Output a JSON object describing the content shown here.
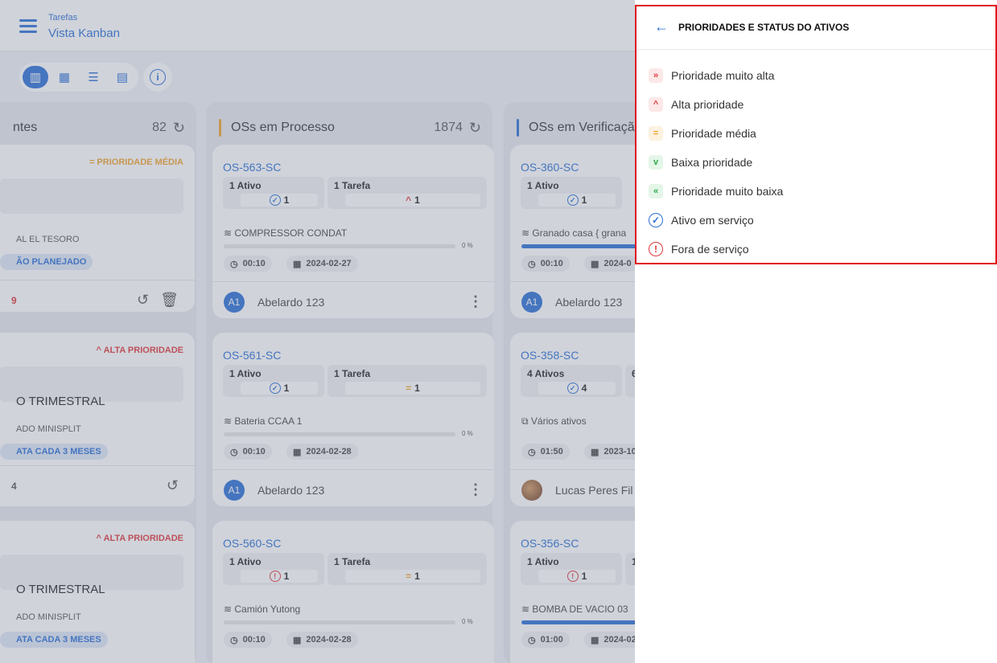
{
  "header": {
    "breadcrumb_small": "Tarefas",
    "breadcrumb_title": "Vista Kanban"
  },
  "view_toolbar": {
    "icons": [
      "kanban-icon",
      "calendar-icon",
      "checklist-icon",
      "clipboard-icon"
    ],
    "info_icon": "i"
  },
  "columns": [
    {
      "title": "ntes",
      "count": "82"
    },
    {
      "title": "OSs em Processo",
      "count": "1874"
    },
    {
      "title": "OSs em Verificaçã",
      "count": ""
    }
  ],
  "left_cards": [
    {
      "priority": "= PRIORIDADE MÉDIA",
      "big_text": "",
      "location": "AL EL TESORO",
      "pill": "ÃO PLANEJADO",
      "foot_fragment": "9"
    },
    {
      "priority": "^ ALTA PRIORIDADE",
      "big_text": "O TRIMESTRAL",
      "location": "ADO MINISPLIT",
      "pill": "ATA CADA 3 MESES",
      "foot_fragment": "4"
    },
    {
      "priority": "^ ALTA PRIORIDADE",
      "big_text": "O TRIMESTRAL",
      "location": "ADO MINISPLIT",
      "pill": "ATA CADA 3 MESES",
      "foot_fragment": ""
    }
  ],
  "process_cards": [
    {
      "code": "OS-563-SC",
      "assets_label": "1 Ativo",
      "assets_value": "1",
      "tasks_label": "1 Tarefa",
      "tasks_value": "1",
      "asset": "COMPRESSOR CONDAT",
      "percent": "0 %",
      "time": "00:10",
      "date": "2024-02-27",
      "user_initials": "A1",
      "user": "Abelardo 123"
    },
    {
      "code": "OS-561-SC",
      "assets_label": "1 Ativo",
      "assets_value": "1",
      "tasks_label": "1 Tarefa",
      "tasks_value": "1",
      "asset": "Bateria CCAA 1",
      "percent": "0 %",
      "time": "00:10",
      "date": "2024-02-28",
      "user_initials": "A1",
      "user": "Abelardo 123"
    },
    {
      "code": "OS-560-SC",
      "assets_label": "1 Ativo",
      "assets_value": "1",
      "tasks_label": "1 Tarefa",
      "tasks_value": "1",
      "asset": "Camión Yutong",
      "percent": "0 %",
      "time": "00:10",
      "date": "2024-02-28"
    }
  ],
  "verify_cards": [
    {
      "code": "OS-360-SC",
      "assets_label": "1 Ativo",
      "assets_value": "1",
      "asset": "Granado casa  { grana",
      "time": "00:10",
      "date": "2024-0",
      "user_initials": "A1",
      "user": "Abelardo 123"
    },
    {
      "code": "OS-358-SC",
      "assets_label": "4 Ativos",
      "tasks_fragment": "6",
      "assets_value": "4",
      "asset": "Vários ativos",
      "time": "01:50",
      "date": "2023-10",
      "user": "Lucas Peres Fil"
    },
    {
      "code": "OS-356-SC",
      "assets_label": "1 Ativo",
      "tasks_fragment": "1",
      "assets_value": "1",
      "asset": "BOMBA DE VACIO 03",
      "time": "01:00",
      "date": "2024-02"
    }
  ],
  "panel": {
    "title": "PRIORIDADES E STATUS DO ATIVOS",
    "items": [
      {
        "icon": "»",
        "label": "Prioridade muito alta",
        "color": "#e0383b",
        "bg": "#fde8e8"
      },
      {
        "icon": "^",
        "label": "Alta prioridade",
        "color": "#e0383b",
        "bg": "#fde8e8"
      },
      {
        "icon": "=",
        "label": "Prioridade média",
        "color": "#f2a32c",
        "bg": "#fdf2df"
      },
      {
        "icon": "v",
        "label": "Baixa prioridade",
        "color": "#2eaa4a",
        "bg": "#e4f6e8"
      },
      {
        "icon": "«",
        "label": "Prioridade muito baixa",
        "color": "#2eaa4a",
        "bg": "#e4f6e8"
      },
      {
        "icon": "✓",
        "label": "Ativo em serviço",
        "color": "#2a6fd6",
        "bg": ""
      },
      {
        "icon": "!",
        "label": "Fora de serviço",
        "color": "#e0383b",
        "bg": ""
      }
    ]
  }
}
